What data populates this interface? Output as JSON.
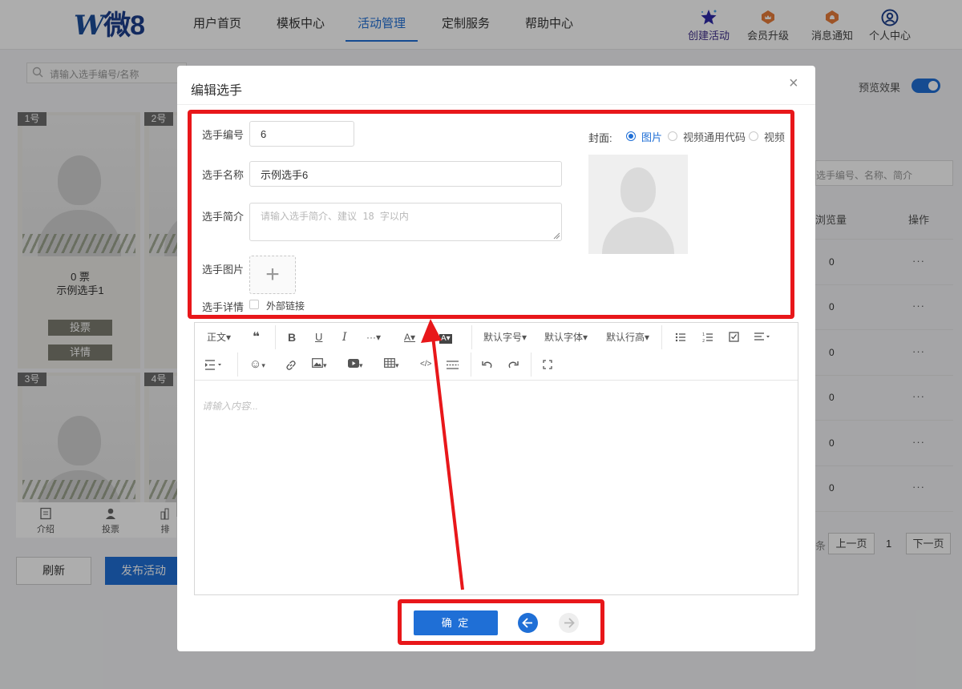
{
  "brand": {
    "logo_w": "W",
    "logo_text": "微8"
  },
  "nav": {
    "items": [
      "用户首页",
      "模板中心",
      "活动管理",
      "定制服务",
      "帮助中心"
    ],
    "active_index": 2,
    "right": [
      {
        "label": "创建活动",
        "icon": "star-icon"
      },
      {
        "label": "会员升级",
        "icon": "crown-badge-icon"
      },
      {
        "label": "消息通知",
        "icon": "bell-badge-icon"
      },
      {
        "label": "个人中心",
        "icon": "user-circle-icon"
      }
    ]
  },
  "background": {
    "search_placeholder": "请输入选手编号/名称",
    "cards": [
      {
        "num": "1号"
      },
      {
        "num": "2号"
      },
      {
        "num": "3号"
      },
      {
        "num": "4号"
      }
    ],
    "card1_votes": "0 票",
    "card1_name": "示例选手1",
    "vote_button": "投票",
    "detail_button": "详情",
    "footer_tabs": [
      "介绍",
      "投票",
      "排"
    ],
    "refresh_button": "刷新",
    "publish_button": "发布活动",
    "preview_label": "预览效果",
    "right_search_placeholder": "选手编号、名称、简介",
    "col_views": "浏览量",
    "col_ops": "操作",
    "row_values": [
      "0",
      "0",
      "0",
      "0",
      "0",
      "0"
    ],
    "row_more": "···",
    "pager": {
      "suffix": "条",
      "prev": "上一页",
      "page": "1",
      "next": "下一页"
    }
  },
  "modal": {
    "title": "编辑选手",
    "close": "×",
    "fields": {
      "number_label": "选手编号",
      "number_value": "6",
      "name_label": "选手名称",
      "name_value": "示例选手6",
      "intro_label": "选手简介",
      "intro_placeholder": "请输入选手简介、建议 18 字以内",
      "image_label": "选手图片",
      "upload_plus": "+",
      "detail_label": "选手详情",
      "external_link_label": "外部链接"
    },
    "cover": {
      "label": "封面:",
      "options": [
        "图片",
        "视频通用代码",
        "视频"
      ],
      "selected": "图片"
    },
    "toolbar": {
      "row1": [
        "正文▾",
        "❝",
        "B",
        "U",
        "I",
        "···▾",
        "A▾",
        "A▾",
        "默认字号▾",
        "默认字体▾",
        "默认行高▾"
      ],
      "row2_labels": [
        "▾",
        "▾",
        "▾",
        "▾",
        "▾",
        "</>"
      ]
    },
    "editor_placeholder": "请输入内容...",
    "confirm_button": "确 定"
  },
  "colors": {
    "accent": "#1f6fd6",
    "annotation_red": "#e8171a",
    "logo_blue": "#1c3f8c"
  }
}
